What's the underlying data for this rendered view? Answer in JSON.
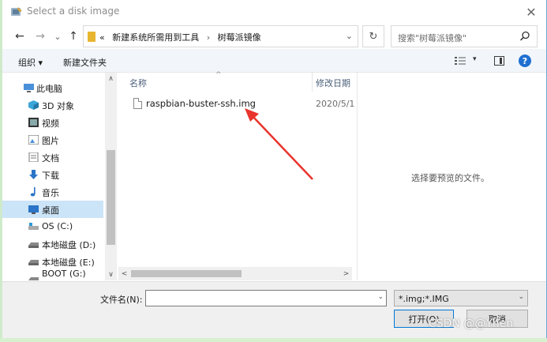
{
  "window": {
    "title": "Select a disk image",
    "close": "✕"
  },
  "nav": {
    "back": "←",
    "forward": "→",
    "recent": "⌄",
    "up": "↑",
    "overflow": "«",
    "path": [
      "新建系统所需用到工具",
      "树莓派镜像"
    ],
    "path_sep": "›",
    "address_chevron": "⌄",
    "refresh": "↻",
    "search_placeholder": "搜索\"树莓派镜像\""
  },
  "toolbar": {
    "organize": "组织 ▾",
    "new_folder": "新建文件夹",
    "view_dropdown": "▾",
    "help": "?"
  },
  "sidebar": {
    "items": [
      {
        "label": "此电脑",
        "icon": "computer-icon"
      },
      {
        "label": "3D 对象",
        "icon": "3d-objects-icon"
      },
      {
        "label": "视频",
        "icon": "video-icon"
      },
      {
        "label": "图片",
        "icon": "pictures-icon"
      },
      {
        "label": "文档",
        "icon": "documents-icon"
      },
      {
        "label": "下载",
        "icon": "download-icon"
      },
      {
        "label": "音乐",
        "icon": "music-icon"
      },
      {
        "label": "桌面",
        "icon": "desktop-icon",
        "selected": true
      },
      {
        "label": "OS (C:)",
        "icon": "os-drive-icon"
      },
      {
        "label": "本地磁盘 (D:)",
        "icon": "drive-icon"
      },
      {
        "label": "本地磁盘 (E:)",
        "icon": "drive-icon"
      },
      {
        "label": "BOOT (G:)",
        "icon": "drive-icon"
      }
    ],
    "scroll_up": "∧",
    "scroll_down": "∨"
  },
  "file_list": {
    "columns": {
      "name": "名称",
      "sort_indicator": "^",
      "date": "修改日期"
    },
    "files": [
      {
        "name": "raspbian-buster-ssh.img",
        "date": "2020/5/1"
      }
    ],
    "scroll_left": "<",
    "scroll_right": ">"
  },
  "preview": {
    "message": "选择要预览的文件。"
  },
  "footer": {
    "filename_label": "文件名(N):",
    "filename_value": "",
    "filename_drop": "⌄",
    "filter_value": "*.img;*.IMG",
    "filter_drop": "⌄",
    "open_label": "打开(O)",
    "cancel_label": "取消"
  },
  "watermark": "CSDN @@Yhen",
  "colors": {
    "accent": "#0078d7",
    "selected": "#cce4f7",
    "annotation": "#e8342c"
  }
}
